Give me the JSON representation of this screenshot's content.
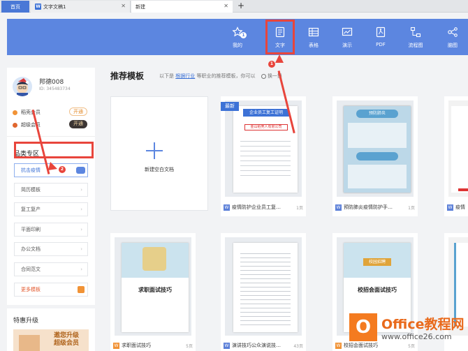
{
  "tabs": {
    "home": "首页",
    "doc": "文字文稿1",
    "new": "新建",
    "add": "+"
  },
  "nav": {
    "items": [
      {
        "key": "mine",
        "label": "我的",
        "badge": "1"
      },
      {
        "key": "text",
        "label": "文字"
      },
      {
        "key": "table",
        "label": "表格"
      },
      {
        "key": "present",
        "label": "演示"
      },
      {
        "key": "pdf",
        "label": "PDF"
      },
      {
        "key": "flow",
        "label": "流程图"
      },
      {
        "key": "mindmap",
        "label": "脑图"
      }
    ]
  },
  "user": {
    "name": "邦德008",
    "id": "ID: 345483734",
    "memberships": [
      {
        "label": "稻壳会员",
        "button": "开通",
        "dot": "#f19336"
      },
      {
        "label": "超级会员",
        "button": "开通",
        "dot": "#e0662e"
      }
    ]
  },
  "category": {
    "title": "品类专区",
    "items": [
      "抗击疫情",
      "简历模板",
      "复工复产",
      "平面印刷",
      "办公文档",
      "合同范文",
      "更多模板"
    ]
  },
  "promo": {
    "title": "特惠升级",
    "text1": "邀您升级",
    "text2": "超级会员"
  },
  "recommend": {
    "title": "推荐模板",
    "sub_prefix": "以下是",
    "sub_link": "根据行业",
    "sub_suffix": "等职业的推荐模板，你可以",
    "swap": "换一换"
  },
  "cards": [
    {
      "title": "新建空白文档"
    },
    {
      "tag": "最新",
      "title": "疫情防护企业员工复…",
      "pages": "1页",
      "doc_heading": "企业员工复工证明",
      "doc_company": "金山稻壳人有限公司"
    },
    {
      "title": "预防肺炎疫情防护手…",
      "pages": "1页",
      "doc_heading": "预防肺炎"
    },
    {
      "title": "疫情",
      "pages": ""
    },
    {
      "title": "求职面试技巧",
      "pages": "5页",
      "doc_heading": "求职面试技巧"
    },
    {
      "title": "演讲技巧公众演说技…",
      "pages": "43页"
    },
    {
      "title": "校招会面试技巧",
      "pages": "5页",
      "doc_heading": "校招会面试技巧",
      "doc_badge": "校园招聘"
    },
    {
      "title": "",
      "pages": ""
    }
  ],
  "annotations": {
    "n1": "1",
    "n2": "2"
  },
  "watermark": {
    "brand": "Office教程网",
    "url": "www.office26.com",
    "mark": "O"
  },
  "colors": {
    "accent": "#5c86e0",
    "highlight": "#e8453c",
    "orange": "#f19336"
  }
}
